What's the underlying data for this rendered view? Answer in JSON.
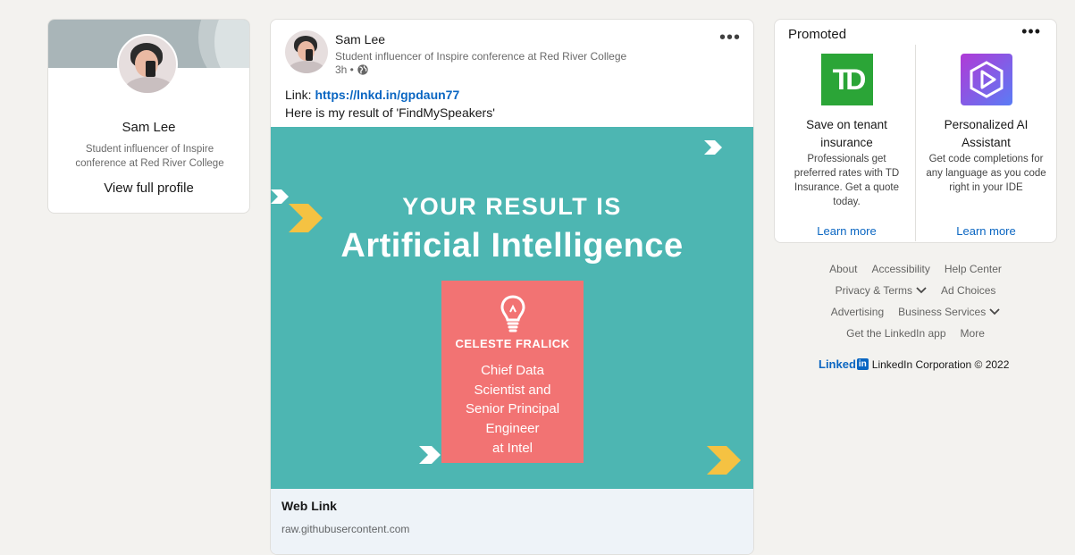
{
  "profile": {
    "name": "Sam Lee",
    "headline": "Student influencer of Inspire conference at Red River College",
    "view_profile": "View full profile"
  },
  "post": {
    "author": "Sam Lee",
    "headline": "Student influencer of Inspire conference at Red River College",
    "time": "3h •",
    "link_label": "Link: ",
    "link_url": "https://lnkd.in/gpdaun77",
    "text": "Here is my result of 'FindMySpeakers'",
    "image": {
      "line1": "YOUR RESULT IS",
      "line2": "Artificial Intelligence",
      "box_name": "CELESTE FRALICK",
      "box_role_lines": [
        "Chief Data",
        "Scientist and",
        "Senior Principal",
        "Engineer",
        "at Intel"
      ]
    },
    "web_link": {
      "title": "Web Link",
      "domain": "raw.githubusercontent.com"
    }
  },
  "ad": {
    "label": "Promoted",
    "left": {
      "logo_text": "TD",
      "title_lines": [
        "Save on tenant",
        "insurance"
      ],
      "desc_lines": [
        "Professionals get",
        "preferred rates with TD",
        "Insurance. Get a quote",
        "today."
      ],
      "cta": "Learn more"
    },
    "right": {
      "title_lines": [
        "Personalized AI",
        "Assistant"
      ],
      "desc_lines": [
        "Get code completions for",
        "any language as you code",
        "right in your IDE"
      ],
      "cta": "Learn more"
    }
  },
  "footer": {
    "row1": [
      "About",
      "Accessibility",
      "Help Center"
    ],
    "row2": [
      "Privacy & Terms",
      "Ad Choices"
    ],
    "row3": [
      "Advertising",
      "Business Services"
    ],
    "row4": [
      "Get the LinkedIn app",
      "More"
    ],
    "brand_logo": "Linked",
    "brand_in": "in",
    "copyright": "LinkedIn Corporation © 2022"
  },
  "colors": {
    "page_bg": "#f3f2ef",
    "link_blue": "#0a66c2",
    "image_teal": "#4db6b2",
    "image_coral": "#f27373",
    "arrow_yellow": "#f5c242",
    "td_green": "#2ba537"
  }
}
